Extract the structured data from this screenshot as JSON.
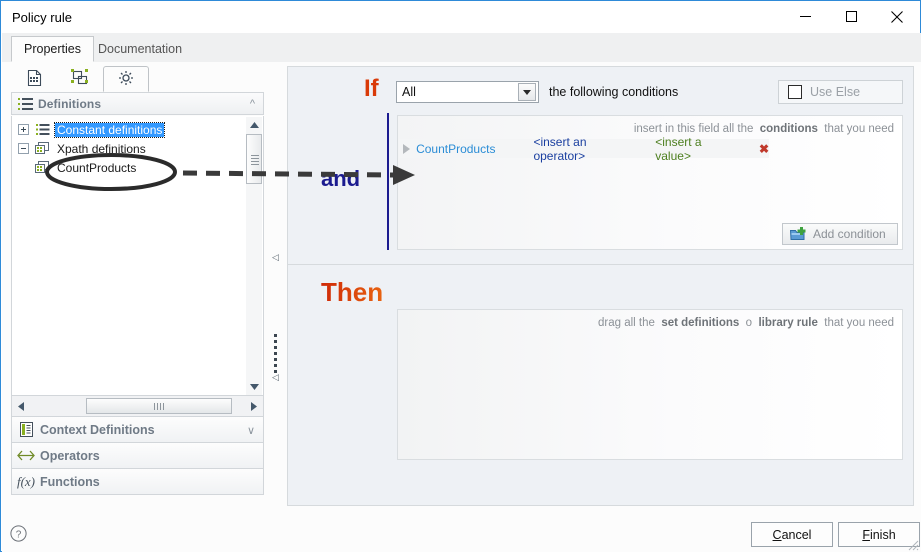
{
  "window": {
    "title": "Policy rule",
    "controls": {
      "minimize": "minimize-icon",
      "maximize": "maximize-icon",
      "close": "close-icon"
    }
  },
  "tabs": [
    {
      "label": "Properties",
      "active": true
    },
    {
      "label": "Documentation",
      "active": false
    }
  ],
  "sidebar": {
    "icon_tabs": [
      {
        "name": "document-icon",
        "active": false
      },
      {
        "name": "shapes-icon",
        "active": false
      },
      {
        "name": "gear-icon",
        "active": true
      }
    ],
    "accordion_header": {
      "label": "Definitions",
      "icon": "list-icon",
      "chevron": "chevron-up-icon"
    },
    "tree": [
      {
        "label": "Constant definitions",
        "expander": "plus",
        "icon": "list-icon",
        "level": 0,
        "selected": true
      },
      {
        "label": "Xpath definitions",
        "expander": "minus",
        "icon": "xpath-icon",
        "level": 0,
        "selected": false
      },
      {
        "label": "CountProducts",
        "expander": "none",
        "icon": "xpath-icon",
        "level": 1,
        "selected": false
      }
    ],
    "panels": [
      {
        "label": "Context Definitions",
        "icon": "book-icon",
        "chevron": "chevron-down-icon"
      },
      {
        "label": "Operators",
        "icon": "operators-icon",
        "chevron": ""
      },
      {
        "label": "Functions",
        "icon": "function-icon",
        "chevron": ""
      }
    ]
  },
  "rule": {
    "if_keyword": "If",
    "and_keyword": "and",
    "then_keyword": "Then",
    "quantifier": {
      "value": "All",
      "suffix": "the following conditions"
    },
    "use_else": {
      "label": "Use Else",
      "checked": false
    },
    "conditions_hint": {
      "prefix": "insert in this field all the",
      "strong": "conditions",
      "suffix": "that you need"
    },
    "condition_row": {
      "field": "CountProducts",
      "operator": "<insert an operator>",
      "value": "<insert a value>",
      "delete": "✖"
    },
    "add_condition": {
      "label": "Add condition",
      "icon": "add-folder-icon"
    },
    "then_hint": {
      "prefix": "drag all the",
      "strong1": "set definitions",
      "middle": "o",
      "strong2": "library rule",
      "suffix": "that you need"
    }
  },
  "footer": {
    "help": "?",
    "cancel": {
      "accel": "C",
      "rest": "ancel"
    },
    "finish": {
      "accel": "F",
      "rest": "inish"
    }
  },
  "colors": {
    "if_keyword": "#d93a08",
    "and_keyword": "#1b1b8f",
    "then_start": "#cf2a08",
    "then_end": "#e8620f",
    "field": "#2b8dd6",
    "operator": "#1a3fa0",
    "value": "#4d7f1f",
    "delete": "#c0392b",
    "selection": "#3399ff",
    "window_border": "#2e8ad8"
  }
}
